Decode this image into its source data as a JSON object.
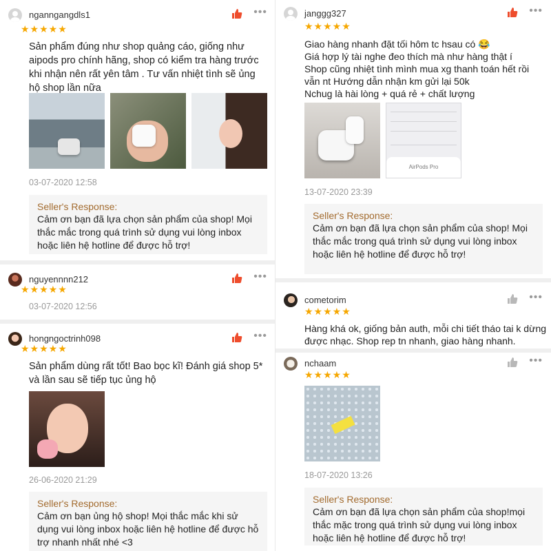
{
  "reviews_left": [
    {
      "username": "nganngangdls1",
      "stars": "★★★★★",
      "content": "Sản phẩm đúng như shop quảng cáo, giống như aipods pro chính hãng, shop có kiểm tra hàng trước khi nhận nên rất yên tâm . Tư vấn nhiệt tình sẽ ủng hộ shop lần nữa",
      "date": "03-07-2020 12:58",
      "response_title": "Seller's Response:",
      "response_text": "Cảm ơn bạn đã lựa chọn sản phẩm của shop! Mọi thắc mắc trong quá trình sử dụng vui lòng inbox hoặc liên hệ hotline để được hỗ trợ!",
      "liked": true
    },
    {
      "username": "nguyennnn212",
      "stars": "★★★★★",
      "date": "03-07-2020 12:56",
      "liked": true
    },
    {
      "username": "hongngoctrinh098",
      "stars": "★★★★★",
      "content": "Sản phẩm dùng rất tốt! Bao bọc kĩ! Đánh giá shop 5* và lần sau sẽ tiếp tục ủng hộ",
      "date": "26-06-2020 21:29",
      "response_title": "Seller's Response:",
      "response_text": "Cảm ơn bạn ủng hộ shop! Mọi thắc mắc khi sử dụng vui lòng inbox hoặc liên hệ hotline để được hỗ trợ nhanh nhất nhé <3",
      "liked": true
    }
  ],
  "reviews_right": [
    {
      "username": "janggg327",
      "stars": "★★★★★",
      "content_lines": [
        "Giao hàng nhanh đặt tối hôm tc hsau có 😂",
        "Giá hợp lý tài nghe đeo thích mà như hàng thật í",
        "Shop cũng nhiệt tình mình mua xg thanh toán hết rồi vẫn nt Hướng dẫn nhận km gửi lại 50k",
        "Nchug là hài lòng + quá rẻ + chất lượng"
      ],
      "phone_popup": "AirPods Pro",
      "date": "13-07-2020 23:39",
      "response_title": "Seller's Response:",
      "response_text": "Cảm ơn bạn đã lựa chọn sản phẩm của shop! Mọi thắc mắc trong quá trình sử dụng vui lòng inbox hoặc liên hệ hotline để được hỗ trợ!",
      "liked": true
    },
    {
      "username": "cometorim",
      "stars": "★★★★★",
      "content": "Hàng khá ok, giống bản auth, mỗi chi tiết tháo tai k dừng được nhạc. Shop rep tn nhanh, giao hàng nhanh.",
      "liked": false
    },
    {
      "username": "nchaam",
      "stars": "★★★★★",
      "date": "18-07-2020 13:26",
      "response_title": "Seller's Response:",
      "response_text": "Cảm ơn bạn đã lựa chọn sản phẩm của shop!mọi thắc mặc trong quá trình sử dụng vui lòng inbox hoặc liên hệ hotline để được hỗ trợ!",
      "liked": false
    }
  ],
  "icons": {
    "like": "thumbs-up-icon",
    "more": "more-dots-icon",
    "more_glyph": "•••"
  },
  "colors": {
    "star": "#f6a700",
    "like_active": "#ee4d2d",
    "response_title": "#a26a2d"
  }
}
